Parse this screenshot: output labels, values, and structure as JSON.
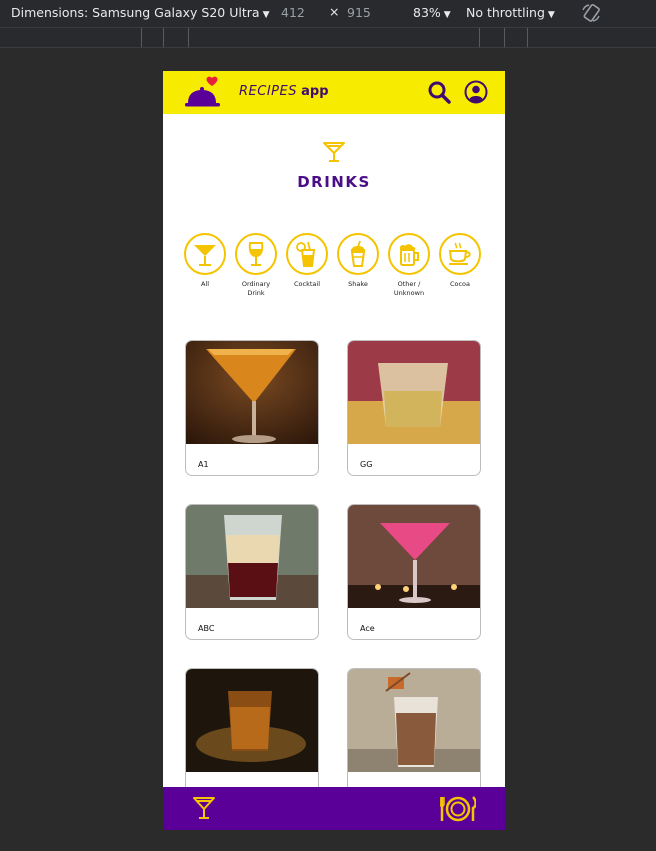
{
  "devtools": {
    "device_label": "Dimensions: Samsung Galaxy S20 Ultra",
    "width": "412",
    "times": "×",
    "height": "915",
    "zoom": "83%",
    "throttling": "No throttling",
    "caret": "▼"
  },
  "app": {
    "brand_recipes": "RECIPES",
    "brand_app": "app",
    "page_title": "DRINKS"
  },
  "filters": [
    {
      "label": "All",
      "icon": "martini-glass-icon"
    },
    {
      "label": "Ordinary Drink",
      "icon": "wine-glass-icon"
    },
    {
      "label": "Cocktail",
      "icon": "cocktail-straw-icon"
    },
    {
      "label": "Shake",
      "icon": "shake-cup-icon"
    },
    {
      "label": "Other / Unknown",
      "icon": "beer-mug-icon"
    },
    {
      "label": "Cocoa",
      "icon": "coffee-cup-icon"
    }
  ],
  "drinks": [
    {
      "name": "A1"
    },
    {
      "name": "GG"
    },
    {
      "name": "ABC"
    },
    {
      "name": "Ace"
    },
    {
      "name": ""
    },
    {
      "name": ""
    }
  ],
  "colors": {
    "header": "#f7ec00",
    "accent_yellow": "#f5c400",
    "purple": "#5a0099",
    "title_purple": "#4a0e86"
  }
}
